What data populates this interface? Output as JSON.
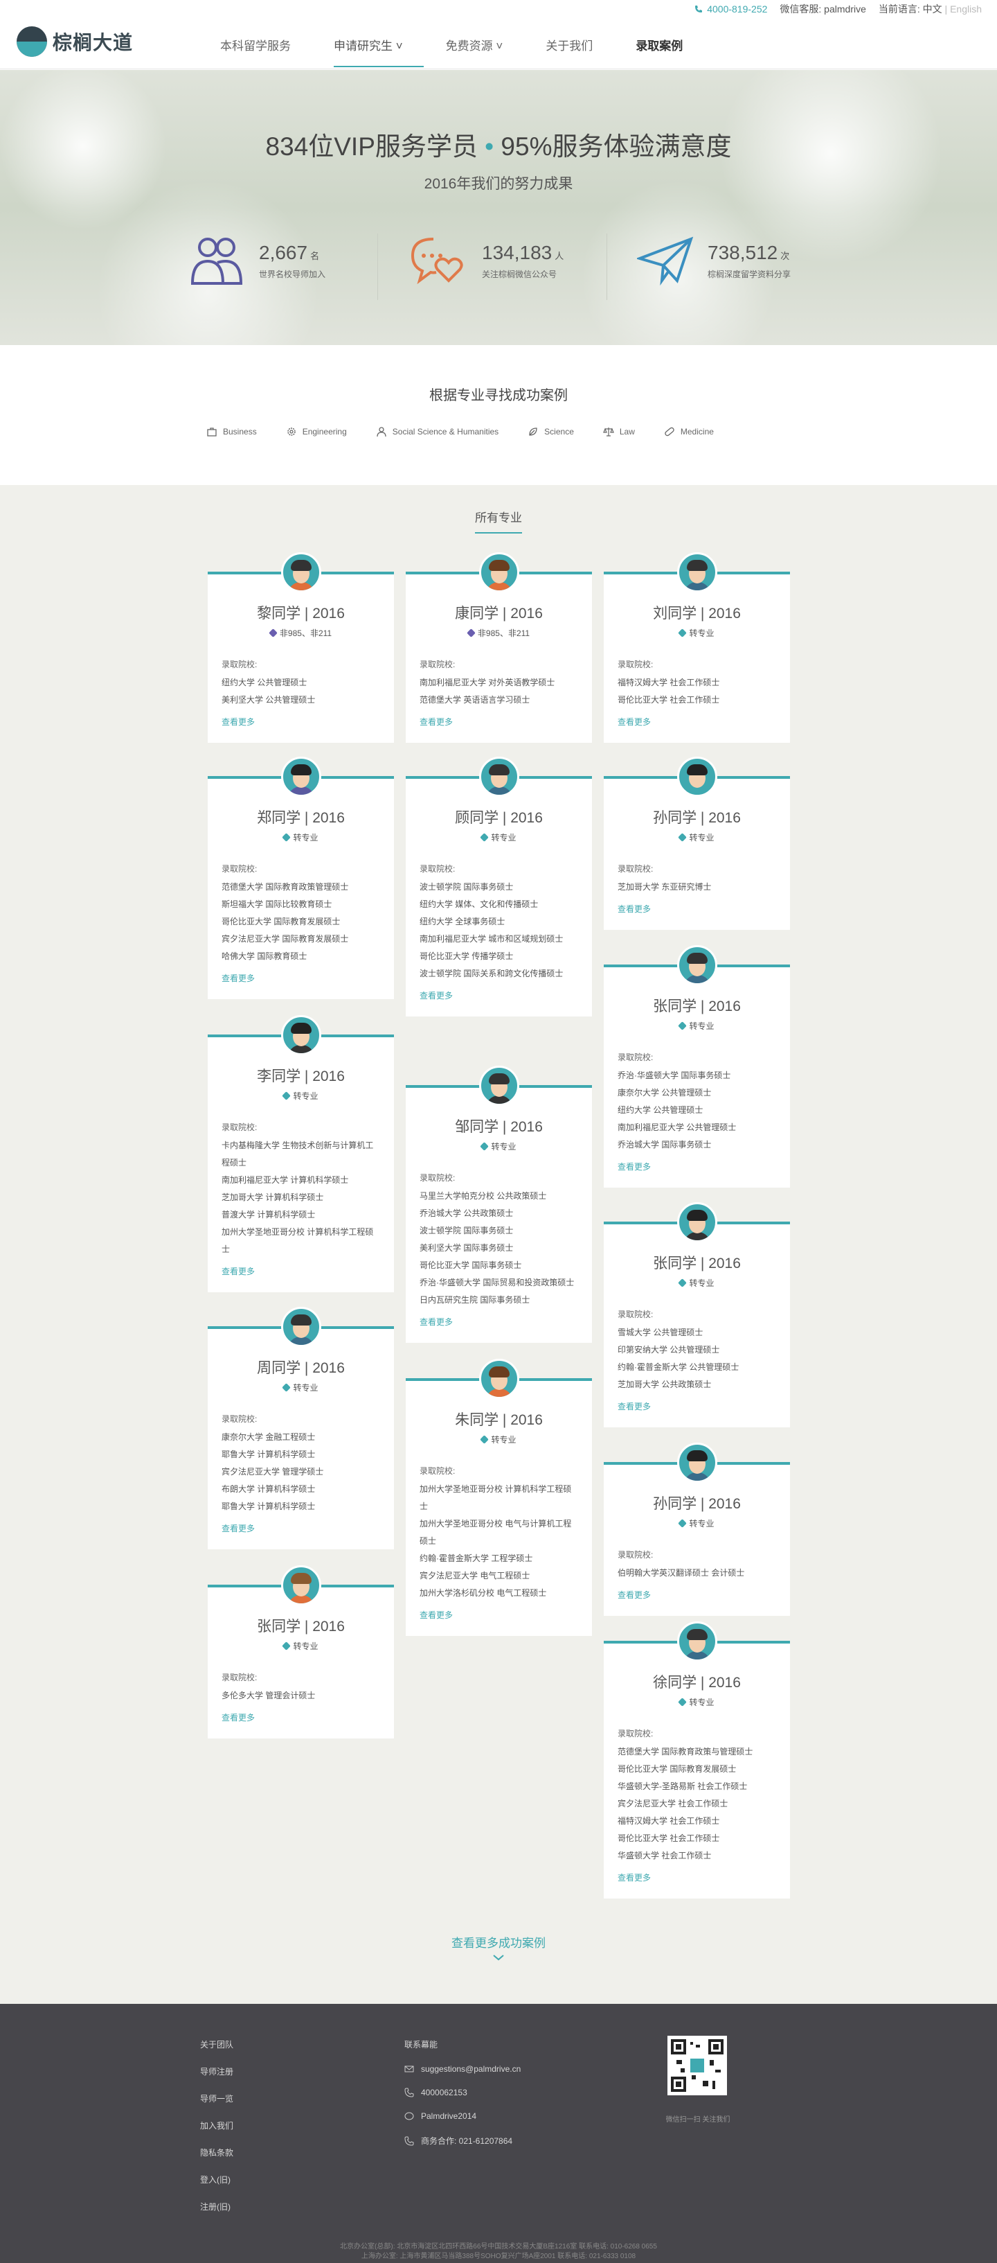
{
  "topbar": {
    "phone": "4000-819-252",
    "wechat": "微信客服: palmdrive",
    "lang_label": "当前语言:",
    "lang_cn": "中文",
    "sep": "|",
    "lang_en": "English"
  },
  "logo": {
    "text": "棕榈大道"
  },
  "nav": [
    {
      "label": "本科留学服务"
    },
    {
      "label": "申请研究生 ˅"
    },
    {
      "label": "免费资源 ˅"
    },
    {
      "label": "关于我们"
    },
    {
      "label": "录取案例"
    }
  ],
  "hero": {
    "title_a": "834位VIP服务学员",
    "dot": "•",
    "title_b": "95%服务体验满意度",
    "subtitle": "2016年我们的努力成果",
    "stats": [
      {
        "num": "2,667",
        "unit": "名",
        "label": "世界名校导师加入"
      },
      {
        "num": "134,183",
        "unit": "人",
        "label": "关注棕榈微信公众号"
      },
      {
        "num": "738,512",
        "unit": "次",
        "label": "棕榈深度留学资料分享"
      }
    ]
  },
  "filter": {
    "title": "根据专业寻找成功案例",
    "cats": [
      "Business",
      "Engineering",
      "Social Science & Humanities",
      "Science",
      "Law",
      "Medicine"
    ]
  },
  "gallery": {
    "tab": "所有专业",
    "label": "录取院校:",
    "more": "查看更多",
    "loadmore": "查看更多成功案例"
  },
  "cards": [
    {
      "name": "黎同学 | 2016",
      "tag": "非985、非211",
      "schools": [
        "纽约大学 公共管理硕士",
        "美利坚大学 公共管理硕士"
      ]
    },
    {
      "name": "康同学 | 2016",
      "tag": "非985、非211",
      "schools": [
        "南加利福尼亚大学 对外英语教学硕士",
        "范德堡大学 英语语言学习硕士"
      ]
    },
    {
      "name": "刘同学 | 2016",
      "tag": "转专业",
      "schools": [
        "福特汉姆大学 社会工作硕士",
        "哥伦比亚大学 社会工作硕士"
      ]
    },
    {
      "name": "郑同学 | 2016",
      "tag": "转专业",
      "schools": [
        "范德堡大学 国际教育政策管理硕士",
        "斯坦福大学 国际比较教育硕士",
        "哥伦比亚大学 国际教育发展硕士",
        "宾夕法尼亚大学 国际教育发展硕士",
        "哈佛大学 国际教育硕士"
      ]
    },
    {
      "name": "顾同学 | 2016",
      "tag": "转专业",
      "schools": [
        "波士顿学院 国际事务硕士",
        "纽约大学 媒体、文化和传播硕士",
        "纽约大学 全球事务硕士",
        "南加利福尼亚大学 城市和区域规划硕士",
        "哥伦比亚大学 传播学硕士",
        "波士顿学院 国际关系和跨文化传播硕士"
      ]
    },
    {
      "name": "孙同学 | 2016",
      "tag": "转专业",
      "schools": [
        "芝加哥大学 东亚研究博士"
      ]
    },
    {
      "name": "张同学 | 2016",
      "tag": "转专业",
      "schools": [
        "乔治·华盛顿大学 国际事务硕士",
        "康奈尔大学 公共管理硕士",
        "纽约大学 公共管理硕士",
        "南加利福尼亚大学 公共管理硕士",
        "乔治城大学 国际事务硕士"
      ]
    },
    {
      "name": "李同学 | 2016",
      "tag": "转专业",
      "schools": [
        "卡内基梅隆大学 生物技术创新与计算机工程硕士",
        "南加利福尼亚大学 计算机科学硕士",
        "芝加哥大学 计算机科学硕士",
        "普渡大学 计算机科学硕士",
        "加州大学圣地亚哥分校 计算机科学工程硕士"
      ]
    },
    {
      "name": "邹同学 | 2016",
      "tag": "转专业",
      "schools": [
        "马里兰大学帕克分校 公共政策硕士",
        "乔治城大学 公共政策硕士",
        "波士顿学院 国际事务硕士",
        "美利坚大学 国际事务硕士",
        "哥伦比亚大学 国际事务硕士",
        "乔治·华盛顿大学 国际贸易和投资政策硕士",
        "日内瓦研究生院 国际事务硕士"
      ]
    },
    {
      "name": "张同学 | 2016",
      "tag": "转专业",
      "schools": [
        "雪城大学 公共管理硕士",
        "印第安纳大学 公共管理硕士",
        "约翰·霍普金斯大学 公共管理硕士",
        "芝加哥大学 公共政策硕士"
      ]
    },
    {
      "name": "周同学 | 2016",
      "tag": "转专业",
      "schools": [
        "康奈尔大学 金融工程硕士",
        "耶鲁大学 计算机科学硕士",
        "宾夕法尼亚大学 管理学硕士",
        "布朗大学 计算机科学硕士",
        "耶鲁大学 计算机科学硕士"
      ]
    },
    {
      "name": "朱同学 | 2016",
      "tag": "转专业",
      "schools": [
        "加州大学圣地亚哥分校 计算机科学工程硕士",
        "加州大学圣地亚哥分校 电气与计算机工程硕士",
        "约翰·霍普金斯大学 工程学硕士",
        "宾夕法尼亚大学 电气工程硕士",
        "加州大学洛杉矶分校 电气工程硕士"
      ]
    },
    {
      "name": "孙同学 | 2016",
      "tag": "转专业",
      "schools": [
        "伯明翰大学英汉翻译硕士 会计硕士"
      ]
    },
    {
      "name": "张同学 | 2016",
      "tag": "转专业",
      "schools": [
        "多伦多大学 管理会计硕士"
      ]
    },
    {
      "name": "徐同学 | 2016",
      "tag": "转专业",
      "schools": [
        "范德堡大学 国际教育政策与管理硕士",
        "哥伦比亚大学 国际教育发展硕士",
        "华盛顿大学-圣路易斯 社会工作硕士",
        "宾夕法尼亚大学 社会工作硕士",
        "福特汉姆大学 社会工作硕士",
        "哥伦比亚大学 社会工作硕士",
        "华盛顿大学 社会工作硕士"
      ]
    }
  ],
  "footer": {
    "links": [
      "关于团队",
      "导师注册",
      "导师一览",
      "加入我们",
      "隐私条款",
      "登入(旧)",
      "注册(旧)"
    ],
    "contact_title": "联系幕能",
    "contacts": [
      "suggestions@palmdrive.cn",
      "4000062153",
      "Palmdrive2014",
      "商务合作: 021-61207864"
    ],
    "qr_caption": "微信扫一扫 关注我们",
    "copy1": "北京办公室(总部): 北京市海淀区北四环西路66号中国技术交易大厦B座1216室 联系电话: 010-6268 0655",
    "copy2": "上海办公室: 上海市黄浦区马当路388号SOHO复兴广场A座2001 联系电话: 021-6333 0108"
  },
  "colors": {
    "accent": "#3fa9b0",
    "footer_bg": "#47464b",
    "gallery_bg": "#f0f0eb"
  }
}
